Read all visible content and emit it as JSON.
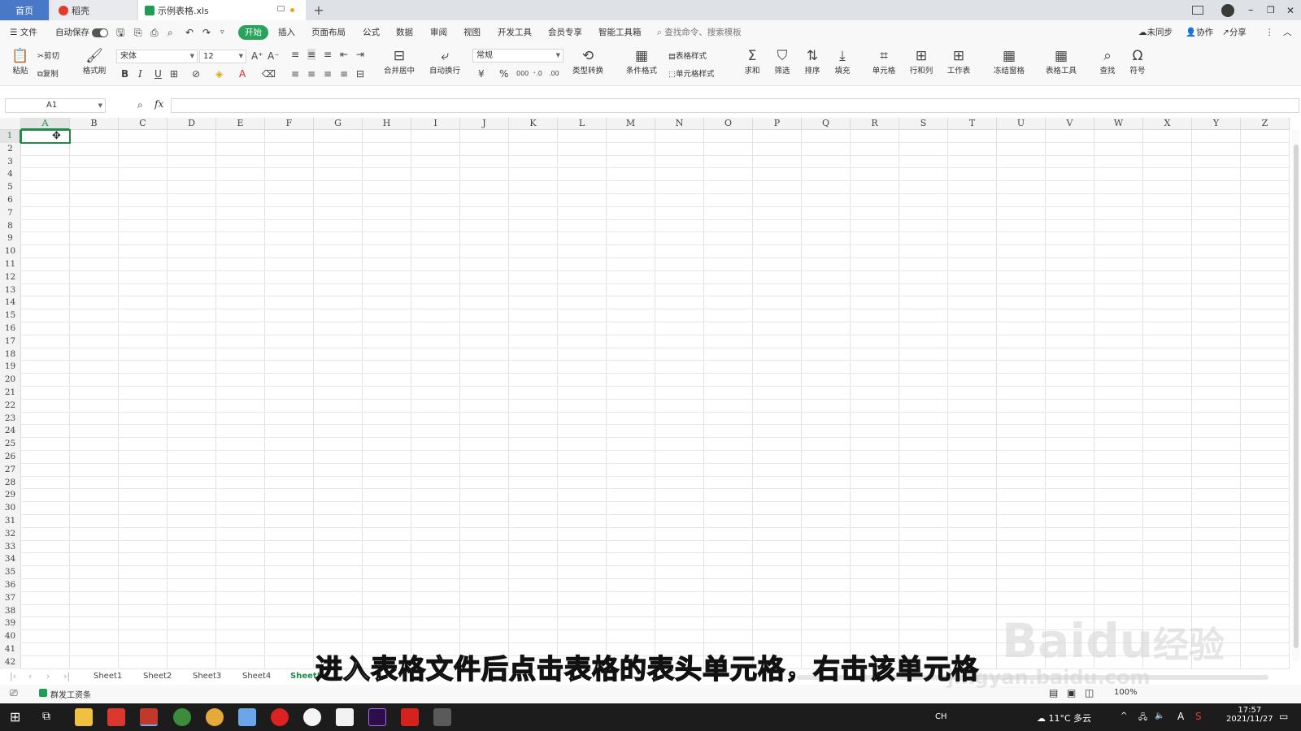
{
  "tabs": {
    "home": "首页",
    "daoke": "稻壳",
    "file": "示例表格.xls",
    "add": "+"
  },
  "menu": {
    "file": "文件",
    "autosave": "自动保存",
    "items": [
      "开始",
      "插入",
      "页面布局",
      "公式",
      "数据",
      "审阅",
      "视图",
      "开发工具",
      "会员专享",
      "智能工具箱"
    ],
    "search_placeholder": "查找命令、搜索模板",
    "sync": "未同步",
    "collab": "协作",
    "share": "分享"
  },
  "ribbon": {
    "paste": "粘贴",
    "cut": "剪切",
    "copy": "复制",
    "format_painter": "格式刷",
    "font": "宋体",
    "font_size": "12",
    "merge": "合并居中",
    "wrap": "自动换行",
    "number_format": "常规",
    "convert": "类型转换",
    "cond_format": "条件格式",
    "table_style": "表格样式",
    "cell_style": "单元格样式",
    "sum": "求和",
    "filter": "筛选",
    "sort": "排序",
    "fill": "填充",
    "cell": "单元格",
    "rowcol": "行和列",
    "sheet": "工作表",
    "freeze": "冻结窗格",
    "tools": "表格工具",
    "find": "查找",
    "symbol": "符号"
  },
  "formula_bar": {
    "name_box": "A1",
    "fx": "fx"
  },
  "columns": [
    "A",
    "B",
    "C",
    "D",
    "E",
    "F",
    "G",
    "H",
    "I",
    "J",
    "K",
    "L",
    "M",
    "N",
    "O",
    "P",
    "Q",
    "R",
    "S",
    "T",
    "U",
    "V",
    "W",
    "X",
    "Y",
    "Z"
  ],
  "rows": [
    "1",
    "2",
    "3",
    "4",
    "5",
    "6",
    "7",
    "8",
    "9",
    "10",
    "11",
    "12",
    "13",
    "14",
    "15",
    "16",
    "17",
    "18",
    "19",
    "20",
    "21",
    "22",
    "23",
    "24",
    "25",
    "26",
    "27",
    "28",
    "29",
    "30",
    "31",
    "32",
    "33",
    "34",
    "35",
    "36",
    "37",
    "38",
    "39",
    "40",
    "41",
    "42"
  ],
  "sheets": [
    "Sheet1",
    "Sheet2",
    "Sheet3",
    "Sheet4",
    "Sheet5"
  ],
  "active_sheet": "Sheet5",
  "status": {
    "macro": "群发工资条",
    "zoom": "100%"
  },
  "subtitle": "进入表格文件后点击表格的表头单元格，右击该单元格",
  "watermark": {
    "brand": "Bai",
    "brand2": "du",
    "brand_cn": "经验",
    "url": "jingyan.baidu.com"
  },
  "taskbar": {
    "lang": "CH",
    "weather": "11°C 多云",
    "ime": "A",
    "time": "17:57",
    "date": "2021/11/27"
  },
  "colors": {
    "accent": "#27a35a",
    "selection": "#1f8c4a",
    "home_tab": "#4a78c8"
  }
}
